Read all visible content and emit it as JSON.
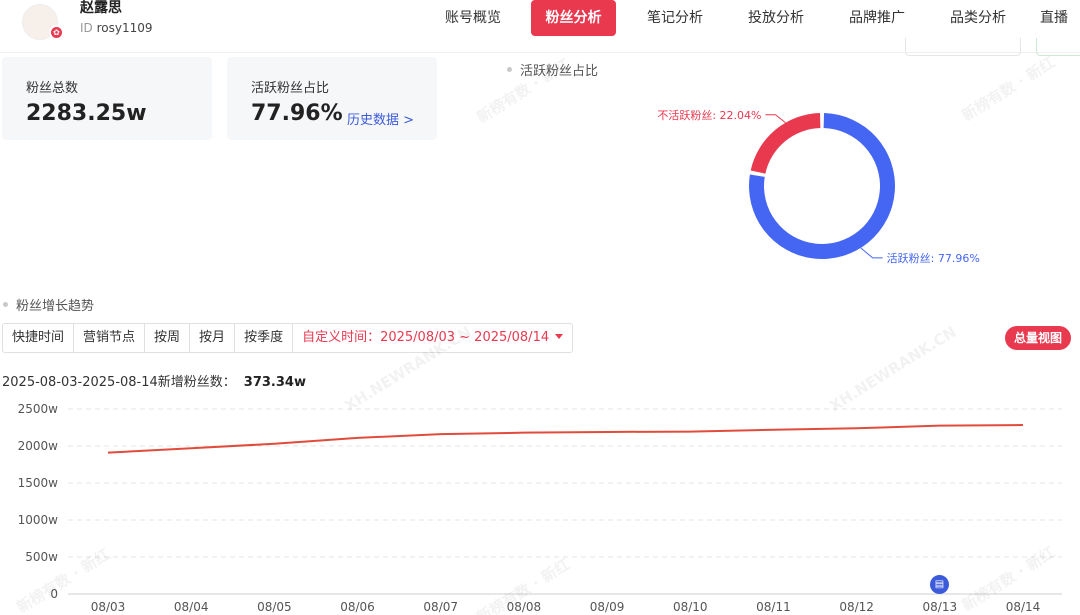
{
  "user": {
    "name": "赵露思",
    "id_prefix": "ID",
    "id": "rosy1109"
  },
  "nav": [
    {
      "label": "账号概览",
      "active": false
    },
    {
      "label": "粉丝分析",
      "active": true
    },
    {
      "label": "笔记分析",
      "active": false
    },
    {
      "label": "投放分析",
      "active": false
    },
    {
      "label": "品牌推广",
      "active": false
    },
    {
      "label": "品类分析",
      "active": false
    },
    {
      "label": "直播",
      "active": false
    }
  ],
  "cards": {
    "total_fans": {
      "label": "粉丝总数",
      "value": "2283.25w"
    },
    "active_ratio": {
      "label": "活跃粉丝占比",
      "value": "77.96%",
      "link": "历史数据 >"
    }
  },
  "active_section": {
    "title": "活跃粉丝占比"
  },
  "growth_section": {
    "title": "粉丝增长趋势"
  },
  "toolbar": {
    "quick": "快捷时间",
    "marketing": "营销节点",
    "week": "按周",
    "month": "按月",
    "quarter": "按季度",
    "custom_label": "自定义时间：",
    "custom_range": "2025/08/03 ~ 2025/08/14",
    "total_view": "总量视图"
  },
  "summary": {
    "label": "2025-08-03-2025-08-14新增粉丝数：",
    "value": "373.34w"
  },
  "watermark_text": "新榜有数 · 新红",
  "watermark_text2": "XH.NEWRANK.CN",
  "colors": {
    "accent": "#e8394f",
    "blue": "#4466f2",
    "line": "#e14b3b"
  },
  "chart_data": [
    {
      "type": "pie",
      "subtype": "donut",
      "title": "活跃粉丝占比",
      "slices": [
        {
          "name": "活跃粉丝",
          "value": 77.96,
          "label": "活跃粉丝: 77.96%",
          "color": "#4466f2"
        },
        {
          "name": "不活跃粉丝",
          "value": 22.04,
          "label": "不活跃粉丝: 22.04%",
          "color": "#e8394f"
        }
      ]
    },
    {
      "type": "line",
      "title": "粉丝增长趋势",
      "x": [
        "08/03",
        "08/04",
        "08/05",
        "08/06",
        "08/07",
        "08/08",
        "08/09",
        "08/10",
        "08/11",
        "08/12",
        "08/13",
        "08/14"
      ],
      "series": [
        {
          "values": [
            1910,
            1970,
            2030,
            2110,
            2160,
            2180,
            2190,
            2195,
            2220,
            2240,
            2275,
            2283.25
          ],
          "color": "#e14b3b"
        }
      ],
      "y_ticks": [
        "0",
        "500w",
        "1000w",
        "1500w",
        "2000w",
        "2500w"
      ],
      "ylim": [
        0,
        2500
      ],
      "grid": true
    }
  ]
}
